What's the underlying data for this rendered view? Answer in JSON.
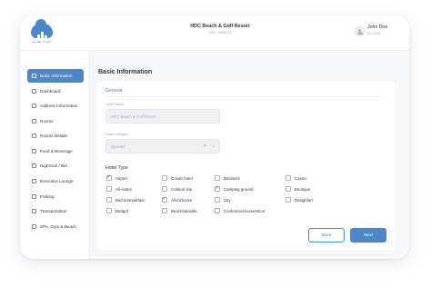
{
  "colors": {
    "accent": "#4f86c6",
    "text": "#2b3445",
    "muted": "#9aa5b5"
  },
  "header": {
    "logo_caption": "HOTEL LOGO",
    "hotel_name": "HDC Beach & Golf Resort",
    "hotel_sub": "HDC · MNR123",
    "user_name": "John Doe",
    "user_role": "ID 12345"
  },
  "sidebar": {
    "items": [
      {
        "label": "Basic Information",
        "icon": "grid-icon",
        "active": true
      },
      {
        "label": "Dashboard",
        "icon": "dashboard-icon"
      },
      {
        "label": "Address Information",
        "icon": "map-pin-icon"
      },
      {
        "label": "Rooms",
        "icon": "bed-icon"
      },
      {
        "label": "Rooms Details",
        "icon": "door-icon"
      },
      {
        "label": "Food & Beverage",
        "icon": "utensils-icon"
      },
      {
        "label": "Nightclub / Bar",
        "icon": "cocktail-icon"
      },
      {
        "label": "Executive Lounge",
        "icon": "sofa-icon"
      },
      {
        "label": "Parking",
        "icon": "parking-icon"
      },
      {
        "label": "Transportation",
        "icon": "bus-icon"
      },
      {
        "label": "SPA, Gym & Beach",
        "icon": "spa-icon"
      }
    ]
  },
  "main": {
    "page_title": "Basic Information",
    "section_title": "General",
    "hotel_name_field": {
      "label": "Hotel Name",
      "value": "HDC Beach & Golf Resort"
    },
    "hotel_category_field": {
      "label": "Hotel Category",
      "value": "Upscale"
    },
    "hotel_type": {
      "label": "Hotel Type",
      "options": [
        {
          "label": "Airport",
          "checked": true
        },
        {
          "label": "Condo hotel",
          "checked": false
        },
        {
          "label": "Business",
          "checked": false
        },
        {
          "label": "Casino",
          "checked": false
        },
        {
          "label": "All-suites",
          "checked": false
        },
        {
          "label": "Cultural site",
          "checked": false
        },
        {
          "label": "Camping ground",
          "checked": true
        },
        {
          "label": "Boutique",
          "checked": false
        },
        {
          "label": "Bed & Breakfast",
          "checked": false
        },
        {
          "label": "All-inclusive",
          "checked": true
        },
        {
          "label": "City",
          "checked": false
        },
        {
          "label": "Design/art",
          "checked": false
        },
        {
          "label": "Budget",
          "checked": false
        },
        {
          "label": "Beach/seaside",
          "checked": false
        },
        {
          "label": "Conference/convention",
          "checked": false
        }
      ]
    },
    "back_label": "Back",
    "next_label": "Next"
  }
}
